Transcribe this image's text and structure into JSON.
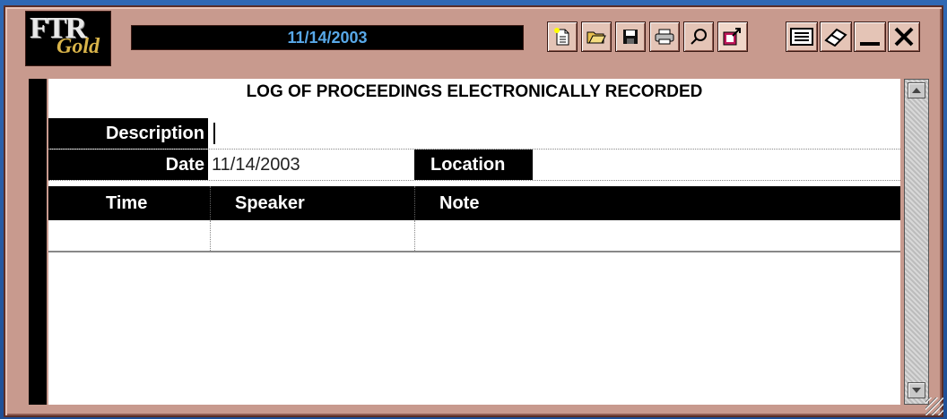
{
  "app": {
    "logo_text": "FTR",
    "logo_sub": "Gold",
    "date_display": "11/14/2003"
  },
  "toolbar": {
    "left": [
      {
        "name": "new-log-icon"
      },
      {
        "name": "open-folder-icon"
      },
      {
        "name": "save-disk-icon"
      },
      {
        "name": "print-icon"
      },
      {
        "name": "search-magnifier-icon"
      },
      {
        "name": "export-icon"
      }
    ],
    "right": [
      {
        "name": "notes-list-icon"
      },
      {
        "name": "eraser-icon"
      },
      {
        "name": "minimize-icon"
      },
      {
        "name": "close-icon"
      }
    ]
  },
  "log": {
    "title": "LOG OF PROCEEDINGS ELECTRONICALLY RECORDED",
    "description_label": "Description",
    "description_value": "",
    "date_label": "Date",
    "date_value": "11/14/2003",
    "location_label": "Location",
    "location_value": "",
    "columns": [
      "Time",
      "Speaker",
      "Note"
    ],
    "rows": [
      {
        "time": "",
        "speaker": "",
        "note": ""
      }
    ]
  },
  "colors": {
    "frame": "#c89a8e",
    "date_text": "#58a8e8",
    "background": "#2a5ea8"
  }
}
